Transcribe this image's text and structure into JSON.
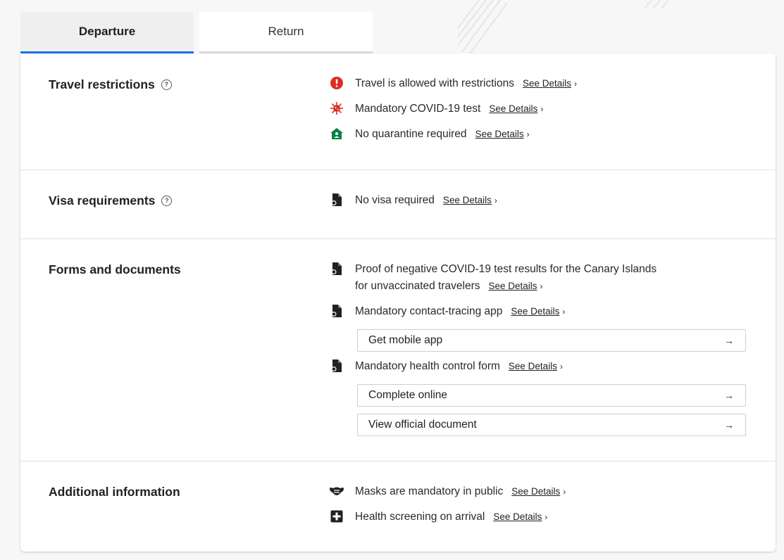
{
  "tabs": [
    {
      "label": "Departure",
      "active": true
    },
    {
      "label": "Return",
      "active": false
    }
  ],
  "accent_color": "#1a73e8",
  "see_details_label": "See Details",
  "sections": {
    "travel_restrictions": {
      "title": "Travel restrictions",
      "items": [
        {
          "text": "Travel is allowed with restrictions",
          "icon": "alert-circle-icon",
          "icon_color": "#d93025"
        },
        {
          "text": "Mandatory COVID-19 test",
          "icon": "virus-icon",
          "icon_color": "#d93025"
        },
        {
          "text": "No quarantine required",
          "icon": "home-person-icon",
          "icon_color": "#0b8043"
        }
      ]
    },
    "visa": {
      "title": "Visa requirements",
      "items": [
        {
          "text": "No visa required",
          "icon": "document-icon"
        }
      ]
    },
    "forms": {
      "title": "Forms and documents",
      "items": [
        {
          "text_line1": "Proof of negative COVID-19 test results for the Canary Islands",
          "text_line2": "for unvaccinated travelers",
          "icon": "document-icon"
        },
        {
          "text": "Mandatory contact-tracing app",
          "icon": "document-icon"
        },
        {
          "text": "Mandatory health control form",
          "icon": "document-icon"
        }
      ],
      "buttons": {
        "get_app": "Get mobile app",
        "complete_online": "Complete online",
        "view_doc": "View official document"
      }
    },
    "additional": {
      "title": "Additional information",
      "items": [
        {
          "text": "Masks are mandatory in public",
          "icon": "mask-icon"
        },
        {
          "text": "Health screening on arrival",
          "icon": "medical-plus-icon"
        }
      ]
    }
  }
}
